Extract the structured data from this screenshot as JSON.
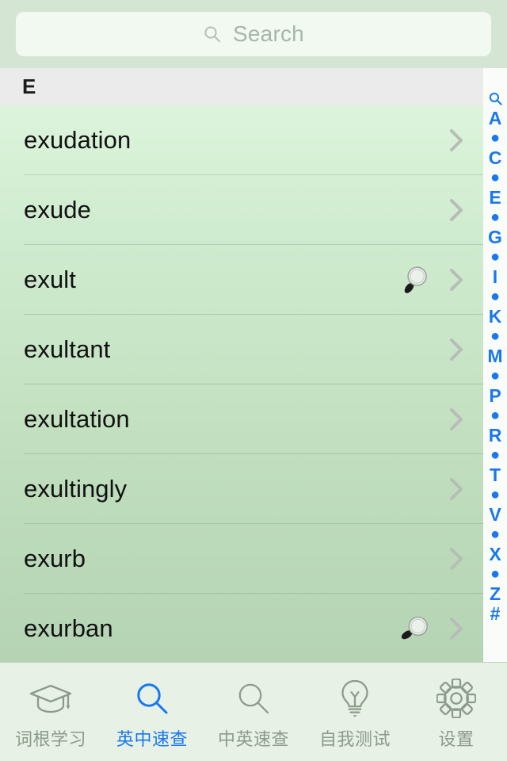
{
  "search": {
    "placeholder": "Search",
    "value": "",
    "icon": "search-icon"
  },
  "section": {
    "header_letter": "E"
  },
  "list": {
    "rows": [
      {
        "word": "exudation",
        "has_magnifier": false,
        "accessory": "chevron-right-icon"
      },
      {
        "word": "exude",
        "has_magnifier": false,
        "accessory": "chevron-right-icon"
      },
      {
        "word": "exult",
        "has_magnifier": true,
        "accessory": "chevron-right-icon"
      },
      {
        "word": "exultant",
        "has_magnifier": false,
        "accessory": "chevron-right-icon"
      },
      {
        "word": "exultation",
        "has_magnifier": false,
        "accessory": "chevron-right-icon"
      },
      {
        "word": "exultingly",
        "has_magnifier": false,
        "accessory": "chevron-right-icon"
      },
      {
        "word": "exurb",
        "has_magnifier": false,
        "accessory": "chevron-right-icon"
      },
      {
        "word": "exurban",
        "has_magnifier": true,
        "accessory": "chevron-right-icon"
      }
    ]
  },
  "index_bar": {
    "entries": [
      {
        "label": "search-icon",
        "type": "icon"
      },
      {
        "label": "A",
        "type": "letter"
      },
      {
        "label": "●",
        "type": "dot"
      },
      {
        "label": "C",
        "type": "letter"
      },
      {
        "label": "●",
        "type": "dot"
      },
      {
        "label": "E",
        "type": "letter"
      },
      {
        "label": "●",
        "type": "dot"
      },
      {
        "label": "G",
        "type": "letter"
      },
      {
        "label": "●",
        "type": "dot"
      },
      {
        "label": "I",
        "type": "letter"
      },
      {
        "label": "●",
        "type": "dot"
      },
      {
        "label": "K",
        "type": "letter"
      },
      {
        "label": "●",
        "type": "dot"
      },
      {
        "label": "M",
        "type": "letter"
      },
      {
        "label": "●",
        "type": "dot"
      },
      {
        "label": "P",
        "type": "letter"
      },
      {
        "label": "●",
        "type": "dot"
      },
      {
        "label": "R",
        "type": "letter"
      },
      {
        "label": "●",
        "type": "dot"
      },
      {
        "label": "T",
        "type": "letter"
      },
      {
        "label": "●",
        "type": "dot"
      },
      {
        "label": "V",
        "type": "letter"
      },
      {
        "label": "●",
        "type": "dot"
      },
      {
        "label": "X",
        "type": "letter"
      },
      {
        "label": "●",
        "type": "dot"
      },
      {
        "label": "Z",
        "type": "letter"
      },
      {
        "label": "#",
        "type": "letter"
      }
    ]
  },
  "tabbar": {
    "tabs": [
      {
        "label": "词根学习",
        "icon": "graduation-cap-icon",
        "active": false
      },
      {
        "label": "英中速查",
        "icon": "magnifier-icon",
        "active": true
      },
      {
        "label": "中英速查",
        "icon": "magnifier-icon",
        "active": false
      },
      {
        "label": "自我测试",
        "icon": "lightbulb-icon",
        "active": false
      },
      {
        "label": "设置",
        "icon": "gear-icon",
        "active": false
      }
    ]
  },
  "colors": {
    "accent_blue": "#1878f0",
    "searchbar_bg": "#d5e5d3",
    "searchfield_bg": "#f1f9f1",
    "section_header_bg": "#ebebeb",
    "list_top": "#dcf4dc",
    "list_bottom": "#b5d4b4",
    "tabbar_bg": "#e7f1e5",
    "inactive_tab": "#8c9a8c",
    "index_bg": "#fafcfa"
  }
}
